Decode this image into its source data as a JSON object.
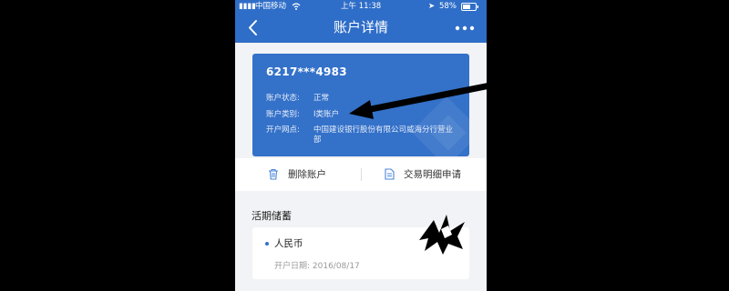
{
  "status_bar": {
    "carrier": "中国移动",
    "time": "上午 11:38",
    "battery": "58%"
  },
  "header": {
    "title": "账户详情",
    "back_icon": "chevron-left-icon",
    "more_icon": "more-dots-icon"
  },
  "account_card": {
    "number": "6217***4983",
    "rows": [
      {
        "label": "账户状态:",
        "value": "正常"
      },
      {
        "label": "账户类别:",
        "value": "I类账户"
      },
      {
        "label": "开户网点:",
        "value": "中国建设银行股份有限公司威海分行营业部"
      }
    ]
  },
  "actions": {
    "delete_label": "删除账户",
    "delete_icon": "trash-icon",
    "statement_label": "交易明细申请",
    "statement_icon": "document-icon"
  },
  "savings": {
    "title": "活期储蓄",
    "currency": "人民币",
    "open_date": "开户日期: 2016/08/17"
  },
  "colors": {
    "primary": "#2f6ec8",
    "card": "#3471c9",
    "background": "#f2f3f6"
  }
}
